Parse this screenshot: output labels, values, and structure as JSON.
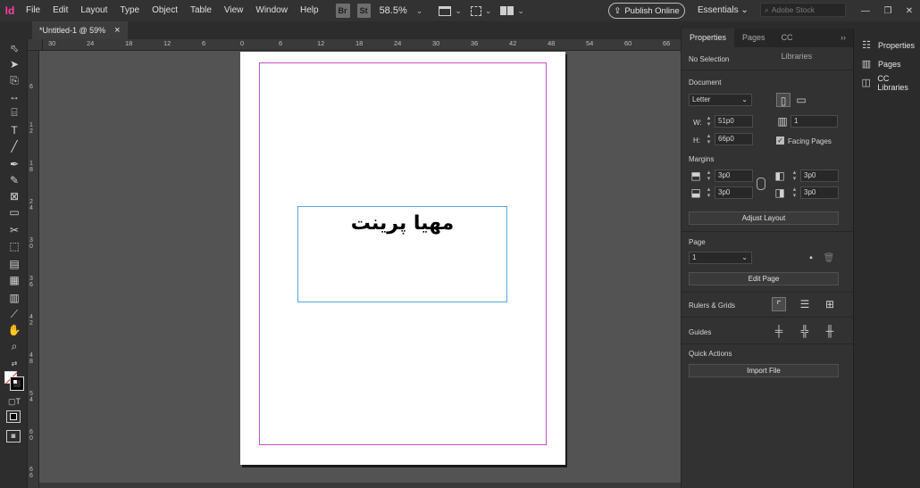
{
  "app": {
    "icon_label": "Id"
  },
  "menu": [
    "File",
    "Edit",
    "Layout",
    "Type",
    "Object",
    "Table",
    "View",
    "Window",
    "Help"
  ],
  "toolbar_buttons": {
    "bridge": "Br",
    "stock": "St",
    "zoom": "58.5%"
  },
  "publish": {
    "label": "Publish Online"
  },
  "workspace": {
    "label": "Essentials"
  },
  "search": {
    "placeholder": "Adobe Stock"
  },
  "document_tab": {
    "title": "*Untitled-1 @ 59%",
    "close": "×"
  },
  "ruler": {
    "h_labels": [
      "30",
      "24",
      "18",
      "12",
      "6",
      "0",
      "6",
      "12",
      "18",
      "24",
      "30",
      "36",
      "42",
      "48",
      "54",
      "60",
      "66"
    ],
    "v_labels": [
      "6",
      "1 2",
      "1 8",
      "2 4",
      "3 0",
      "3 6",
      "4 2",
      "4 8",
      "5 4",
      "6 0",
      "6 6"
    ]
  },
  "canvas": {
    "text": "مهیا پرینت"
  },
  "properties": {
    "tabs": [
      "Properties",
      "Pages",
      "CC Libraries"
    ],
    "tabs_more": "››",
    "selection": "No Selection",
    "document_label": "Document",
    "preset": "Letter",
    "w_label": "W:",
    "w_value": "51p0",
    "h_label": "H:",
    "h_value": "66p0",
    "pages_count": "1",
    "facing_pages_label": "Facing Pages",
    "facing_pages": true,
    "margins_label": "Margins",
    "margin_top": "3p0",
    "margin_bottom": "3p0",
    "margin_left": "3p0",
    "margin_right": "3p0",
    "adjust_layout": "Adjust Layout",
    "page_label": "Page",
    "page_value": "1",
    "edit_page": "Edit Page",
    "rulers_grids_label": "Rulers & Grids",
    "guides_label": "Guides",
    "quick_actions_label": "Quick Actions",
    "import_file": "Import File"
  },
  "dock": [
    "Properties",
    "Pages",
    "CC Libraries"
  ],
  "colors": {
    "margin_guide": "#c74bc7",
    "frame": "#58a8dc",
    "app_accent": "#ff3fa4"
  }
}
